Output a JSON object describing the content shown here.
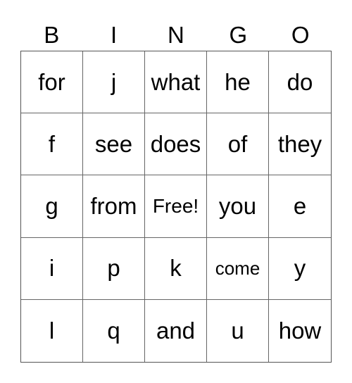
{
  "header": [
    "B",
    "I",
    "N",
    "G",
    "O"
  ],
  "rows": [
    [
      "for",
      "j",
      "what",
      "he",
      "do"
    ],
    [
      "f",
      "see",
      "does",
      "of",
      "they"
    ],
    [
      "g",
      "from",
      "Free!",
      "you",
      "e"
    ],
    [
      "i",
      "p",
      "k",
      "come",
      "y"
    ],
    [
      "l",
      "q",
      "and",
      "u",
      "how"
    ]
  ]
}
